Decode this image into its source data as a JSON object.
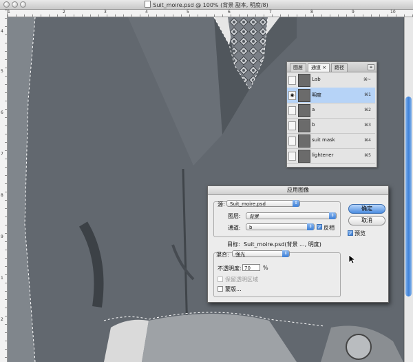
{
  "window": {
    "title": "Suit_moire.psd @ 100% (背景 副本, 明度/8)"
  },
  "ruler": {
    "top_numbers": [
      "1",
      "2",
      "3",
      "4",
      "5",
      "6",
      "7",
      "8",
      "9",
      "10"
    ],
    "left_numbers": [
      "4",
      "5",
      "6",
      "7",
      "8",
      "9",
      "1",
      "2"
    ]
  },
  "channels_panel": {
    "tabs": [
      "图层",
      "通道 ×",
      "路径"
    ],
    "menu_glyph": "≡",
    "channels": [
      {
        "name": "Lab",
        "shortcut": "⌘~",
        "visible": false,
        "selected": false
      },
      {
        "name": "明度",
        "shortcut": "⌘1",
        "visible": true,
        "selected": true
      },
      {
        "name": "a",
        "shortcut": "⌘2",
        "visible": false,
        "selected": false
      },
      {
        "name": "b",
        "shortcut": "⌘3",
        "visible": false,
        "selected": false
      },
      {
        "name": "suit mask",
        "shortcut": "⌘4",
        "visible": false,
        "selected": false
      },
      {
        "name": "lightener",
        "shortcut": "⌘5",
        "visible": false,
        "selected": false
      }
    ]
  },
  "apply_image": {
    "title": "应用图像",
    "source_label": "源:",
    "source_value": "Suit_moire.psd",
    "layer_label": "图层:",
    "layer_value": "背景",
    "channel_label": "通道:",
    "channel_value": "b",
    "invert_label": "反相",
    "invert_checked": true,
    "target_label": "目标:",
    "target_value": "Suit_moire.psd(背景 ..., 明度)",
    "blending_label": "混合:",
    "blending_value": "强光",
    "opacity_label": "不透明度:",
    "opacity_value": "70",
    "opacity_unit": "%",
    "preserve_transparency_label": "保留透明区域",
    "mask_label": "蒙版...",
    "ok_label": "确定",
    "cancel_label": "取消",
    "preview_label": "预览",
    "preview_checked": true
  },
  "colors": {
    "accent": "#3c7fd7",
    "selection": "#b6d3f7",
    "suit": "#5e646b"
  }
}
